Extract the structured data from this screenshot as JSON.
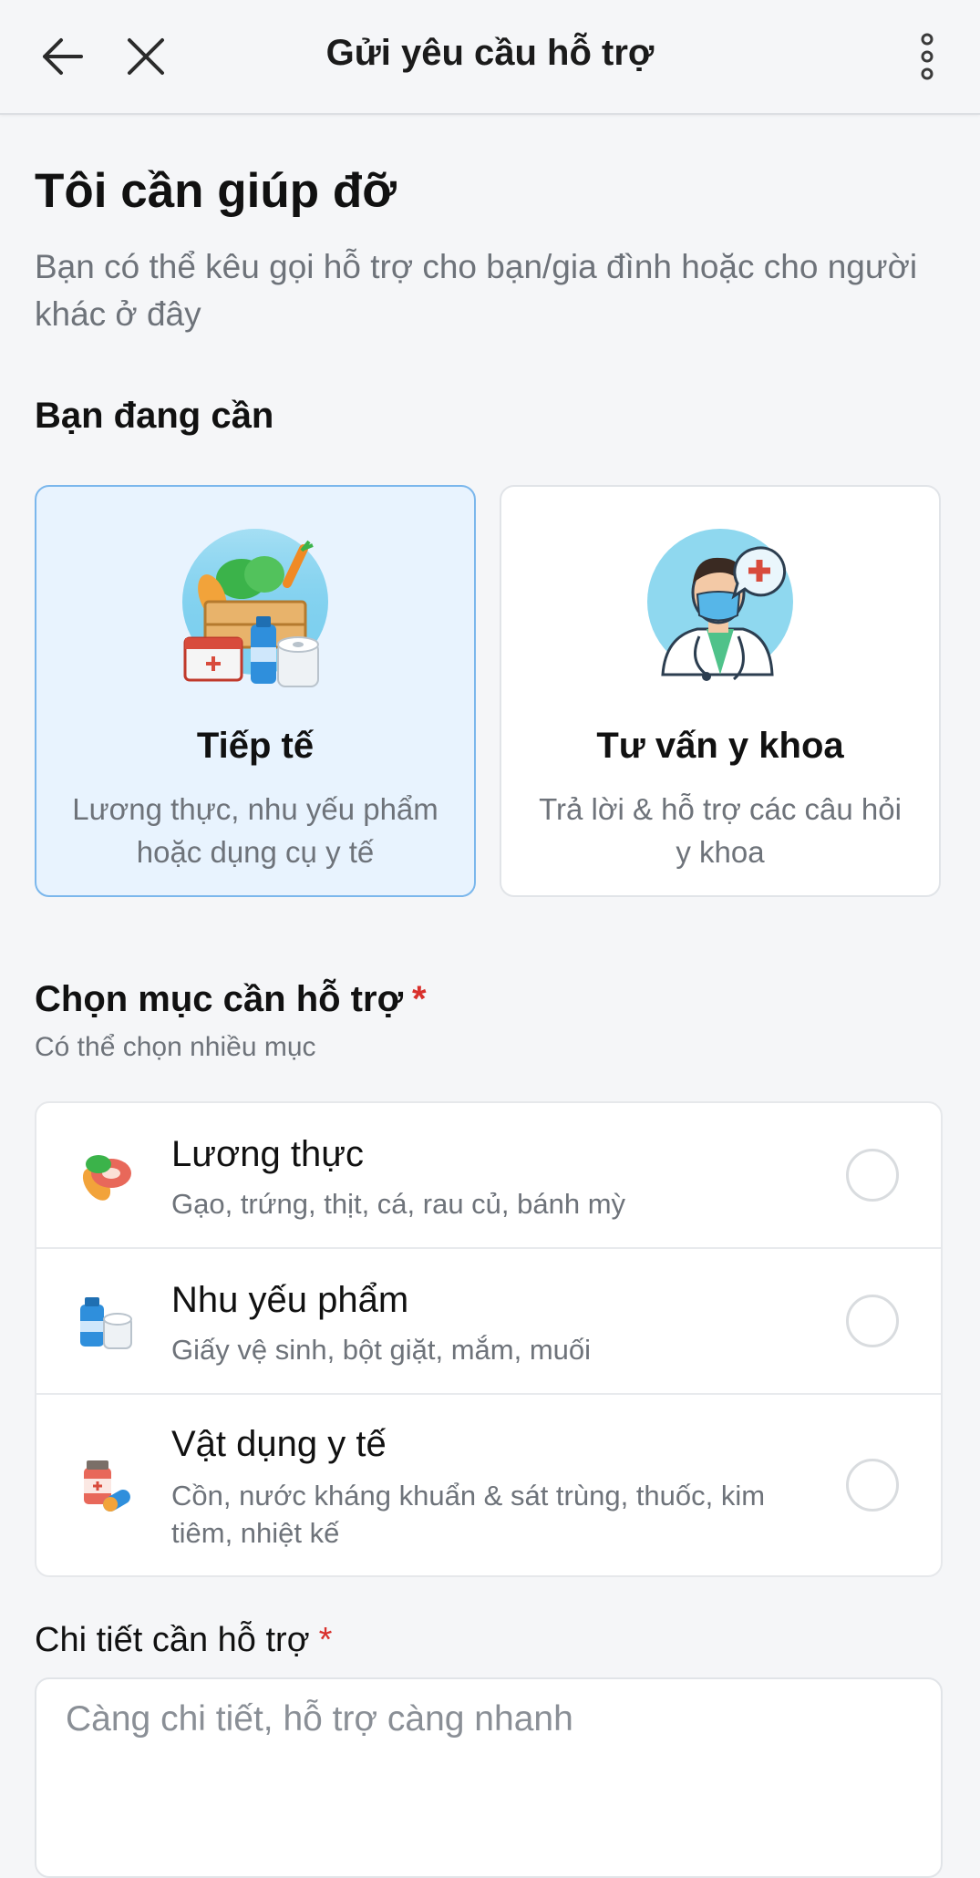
{
  "header": {
    "title": "Gửi yêu cầu hỗ trợ",
    "back_icon": "arrow-left-icon",
    "close_icon": "close-icon",
    "more_icon": "more-vertical-icon"
  },
  "page": {
    "title": "Tôi cần giúp đỡ",
    "subtitle": "Bạn có thể kêu gọi hỗ trợ cho bạn/gia đình hoặc cho người khác ở đây"
  },
  "need_section": {
    "heading": "Bạn đang cần",
    "options": [
      {
        "title": "Tiếp tế",
        "description": "Lương thực, nhu yếu phẩm hoặc dụng cụ y tế",
        "selected": true,
        "icon": "supplies-illustration"
      },
      {
        "title": "Tư vấn y khoa",
        "description": "Trả lời & hỗ trợ các câu hỏi y khoa",
        "selected": false,
        "icon": "doctor-illustration"
      }
    ]
  },
  "category_section": {
    "heading": "Chọn mục cần hỗ trợ",
    "required_mark": "*",
    "hint": "Có thể chọn nhiều mục",
    "items": [
      {
        "label": "Lương thực",
        "description": "Gạo, trứng, thịt, cá, rau củ, bánh mỳ",
        "icon": "food-icon",
        "checked": false
      },
      {
        "label": "Nhu yếu phẩm",
        "description": "Giấy vệ sinh, bột giặt, mắm, muối",
        "icon": "essentials-icon",
        "checked": false
      },
      {
        "label": "Vật dụng y tế",
        "description": "Cồn, nước kháng khuẩn & sát trùng, thuốc, kim tiêm, nhiệt kế",
        "icon": "medicine-icon",
        "checked": false
      }
    ]
  },
  "detail_section": {
    "label": "Chi tiết cần hỗ trợ",
    "required_mark": "*",
    "placeholder": "Càng chi tiết, hỗ trợ càng nhanh",
    "value": ""
  },
  "colors": {
    "accent_border": "#7bb7ec",
    "selected_bg": "#e8f3fe",
    "required": "#d9302c",
    "muted_text": "#6e737a"
  }
}
